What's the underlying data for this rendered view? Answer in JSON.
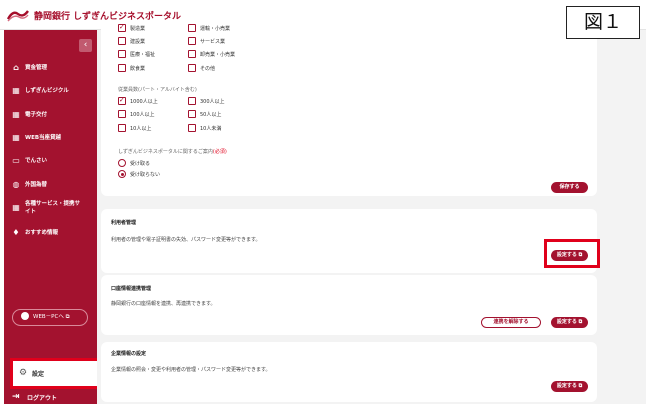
{
  "header": {
    "logo_text": "静岡銀行 しずぎんビジネスポータル"
  },
  "figure_label": "図１",
  "sidebar": {
    "collapse_glyph": "‹",
    "items": [
      {
        "label": "資金管理"
      },
      {
        "label": "しずぎんビジクル"
      },
      {
        "label": "電子交付"
      },
      {
        "label": "WEB当座貸越"
      },
      {
        "label": "でんさい"
      },
      {
        "label": "外国為替"
      },
      {
        "label": "各種サービス・提携サイト"
      },
      {
        "label": "おすすめ情報"
      }
    ],
    "web_pc_label": "WEB－PCへ",
    "settings_label": "設定",
    "logout_label": "ログアウト"
  },
  "main": {
    "industries": [
      {
        "label": "製造業",
        "checked": true
      },
      {
        "label": "運輸・小売業",
        "checked": false
      },
      {
        "label": "建設業",
        "checked": false
      },
      {
        "label": "サービス業",
        "checked": false
      },
      {
        "label": "医療・福祉",
        "checked": false
      },
      {
        "label": "卸売業・小売業",
        "checked": false
      },
      {
        "label": "飲食業",
        "checked": false
      },
      {
        "label": "その他",
        "checked": false
      }
    ],
    "employees_label": "従業員数(パート・アルバイト含む)",
    "employees": [
      {
        "label": "1000人以上",
        "checked": true
      },
      {
        "label": "300人以上",
        "checked": false
      },
      {
        "label": "100人以上",
        "checked": false
      },
      {
        "label": "50人以上",
        "checked": false
      },
      {
        "label": "10人以上",
        "checked": false
      },
      {
        "label": "10人未満",
        "checked": false
      }
    ],
    "guide_label": "しずぎんビジネスポータルに関するご案内",
    "guide_required": "(必須)",
    "radios": [
      {
        "label": "受け取る",
        "selected": false
      },
      {
        "label": "受け取らない",
        "selected": true
      }
    ],
    "save_button": "保存する",
    "user_mgmt": {
      "title": "利用者管理",
      "text": "利用者の管理や電子証明書の失効、パスワード変更等ができます。",
      "button": "設定する ⧉"
    },
    "account_link": {
      "title": "口座情報連携管理",
      "text": "静岡銀行の口座情報を連携、再連携できます。",
      "unlink_button": "連携を解除する",
      "button": "設定する ⧉"
    },
    "company_info": {
      "title": "企業情報の設定",
      "text": "企業情報の照会・変更や利用者の管理・パスワード変更等ができます。",
      "button": "設定する ⧉"
    }
  },
  "colors": {
    "brand": "#a3122f",
    "highlight": "#e0001b"
  },
  "icons": [
    "home-icon",
    "grid-icon",
    "grid-icon",
    "grid-icon",
    "monitor-icon",
    "globe-icon",
    "grid-icon",
    "pin-icon",
    "gear-icon",
    "logout-icon"
  ]
}
